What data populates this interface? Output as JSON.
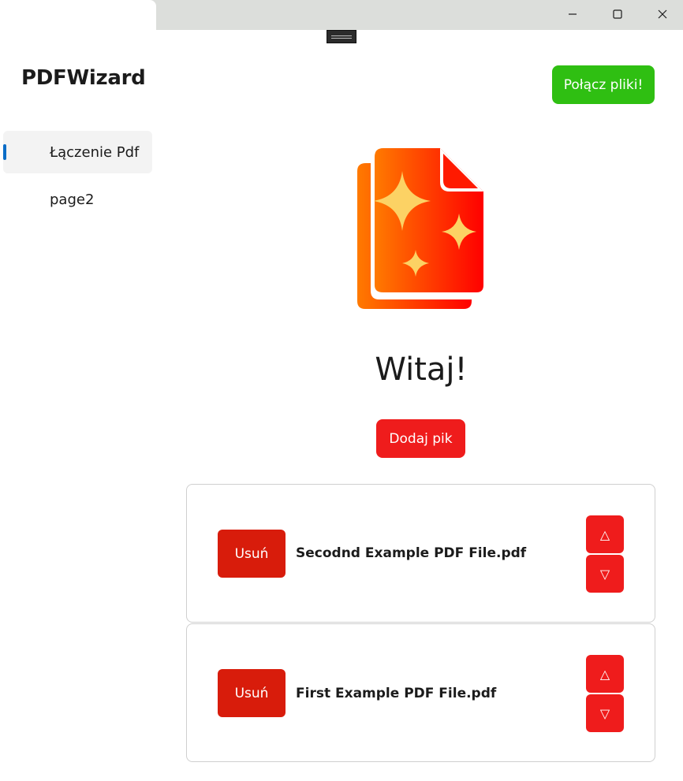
{
  "app": {
    "title": "PDFWizard"
  },
  "window_controls": {
    "minimize": "minimize-icon",
    "maximize": "maximize-icon",
    "close": "close-icon"
  },
  "sidebar": {
    "items": [
      {
        "label": "Łączenie Pdf",
        "active": true
      },
      {
        "label": "page2",
        "active": false
      }
    ]
  },
  "toolbar": {
    "merge_label": "Połącz pliki!"
  },
  "main": {
    "logo_icon": "sparkle-documents-icon",
    "welcome": "Witaj!",
    "add_label": "Dodaj pik"
  },
  "files": [
    {
      "name": "Secodnd Example PDF File.pdf",
      "remove_label": "Usuń",
      "up_label": "△",
      "down_label": "▽"
    },
    {
      "name": "First Example PDF File.pdf",
      "remove_label": "Usuń",
      "up_label": "△",
      "down_label": "▽"
    }
  ],
  "colors": {
    "accent": "#0b6dc7",
    "merge_button": "#2fbf12",
    "add_button": "#ef1c1c",
    "remove_button": "#d81c0b",
    "logo_gradient_start": "#ff7a00",
    "logo_gradient_end": "#ff0000",
    "sparkle": "#fcd264"
  }
}
